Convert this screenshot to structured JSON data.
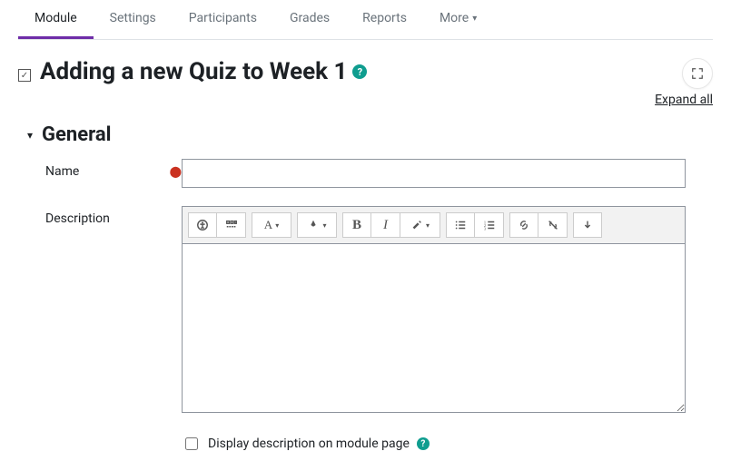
{
  "tabs": {
    "items": [
      {
        "label": "Module"
      },
      {
        "label": "Settings"
      },
      {
        "label": "Participants"
      },
      {
        "label": "Grades"
      },
      {
        "label": "Reports"
      },
      {
        "label": "More"
      }
    ]
  },
  "page": {
    "title": "Adding a new Quiz to Week 1",
    "expand_all": "Expand all"
  },
  "section_general": {
    "heading": "General",
    "name_label": "Name",
    "name_value": "",
    "description_label": "Description",
    "display_description_label": "Display description on module page",
    "display_description_checked": false
  },
  "editor_toolbar": {
    "accessibility": "accessibility-icon",
    "toggle_toolbar": "toggle-toolbar-icon",
    "paragraph": "A",
    "highlight": "highlight-icon",
    "bold": "B",
    "italic": "I",
    "more_format": "more-format-icon",
    "ul": "unordered-list-icon",
    "ol": "ordered-list-icon",
    "link": "link-icon",
    "unlink": "unlink-icon",
    "more": "more-tools-icon"
  }
}
